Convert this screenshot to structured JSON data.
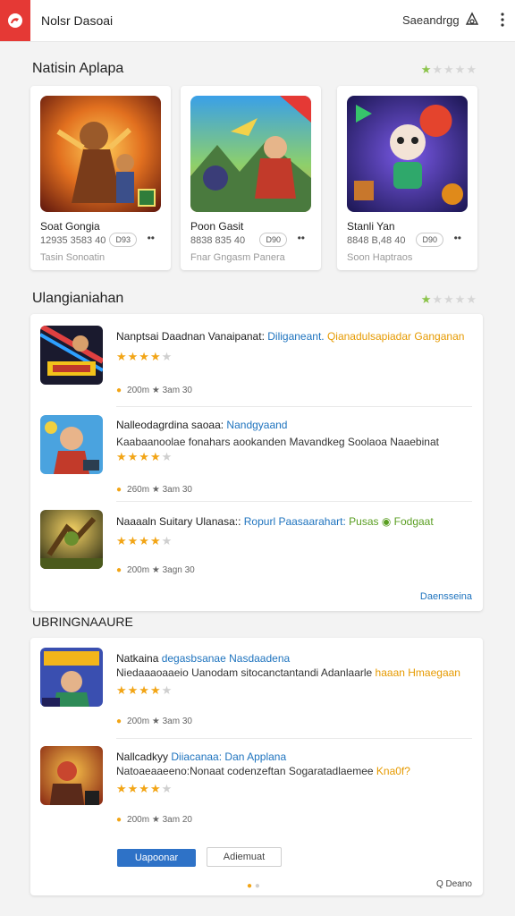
{
  "header": {
    "app_title": "Nolsr Dasoai",
    "action_label": "Saeandrgg",
    "icons": [
      "app-logo-icon",
      "account-icon",
      "more-vert-icon"
    ],
    "brand_color": "#e53935"
  },
  "featured": {
    "title": "Natisin Aplapa",
    "rating": {
      "filled": 1,
      "total": 5
    },
    "cards": [
      {
        "name": "Soat Gongia",
        "meta": "12935 3583 40",
        "pill": "D93",
        "more": "••",
        "sub": "Tasin Sonoatin"
      },
      {
        "name": "Poon Gasit",
        "meta": "8838 835 40",
        "pill": "D90",
        "more": "••",
        "sub": "Fnar Gngasm Panera"
      },
      {
        "name": "Stanli Yan",
        "meta": "8848 B,48 40",
        "pill": "D90",
        "more": "••",
        "sub": "Soon Haptraos"
      }
    ]
  },
  "list1": {
    "title": "Ulangianiahan",
    "rating": {
      "filled": 1,
      "total": 5
    },
    "items": [
      {
        "title_plain": "Nanptsai Daadnan Vanaipanat:",
        "title_blue": " Diliganeant.",
        "title_orange": " Qianadulsapiadar Ganganan",
        "desc_plain": "",
        "desc_orange": "",
        "rating": 4,
        "stats": "200m ★ 3am 30"
      },
      {
        "title_plain": "Nalleodagrdina saoaa:",
        "title_blue": " Nandgyaand",
        "title_orange": "",
        "desc_plain": "Kaabaanoolae fonahars aookanden Mavandkeg Soolaoa Naaebinat",
        "desc_orange": "",
        "rating": 4,
        "stats": "260m ★ 3am 30"
      },
      {
        "title_plain": "Naaaaln Suitary Ulanasa::",
        "title_blue": " Ropurl Paasaarahart:",
        "title_green": " Pusas ◉ Fodgaat",
        "desc_plain": "",
        "desc_orange": "",
        "rating": 4,
        "stats": "200m ★ 3agn 30"
      }
    ],
    "see_more": "Daensseina"
  },
  "list2": {
    "title": "UBRINGNAAURE",
    "items": [
      {
        "title_plain": "Natkaina",
        "title_blue": " degasbsanae Nasdaadena",
        "desc_plain": "Niedaaaoaaeio Uanodam sitocanctantandi Adanlaarle",
        "desc_orange": " haaan Hmaegaan",
        "rating": 4,
        "stats": "200m ★ 3am 30"
      },
      {
        "title_plain": "Nallcadkyy",
        "title_blue": " Diiacanaa: Dan Applana",
        "desc_plain": "Natoaeaaeeno:Nonaat codenzeftan Sogaratadlaemee",
        "desc_orange": " Kna0f?",
        "rating": 4,
        "stats": "200m ★ 3am 20"
      }
    ],
    "primary_button": "Uapoonar",
    "secondary_button": "Adiemuat",
    "footer_link": "Q Deano",
    "page_dots": {
      "active": 1,
      "total": 2
    }
  }
}
